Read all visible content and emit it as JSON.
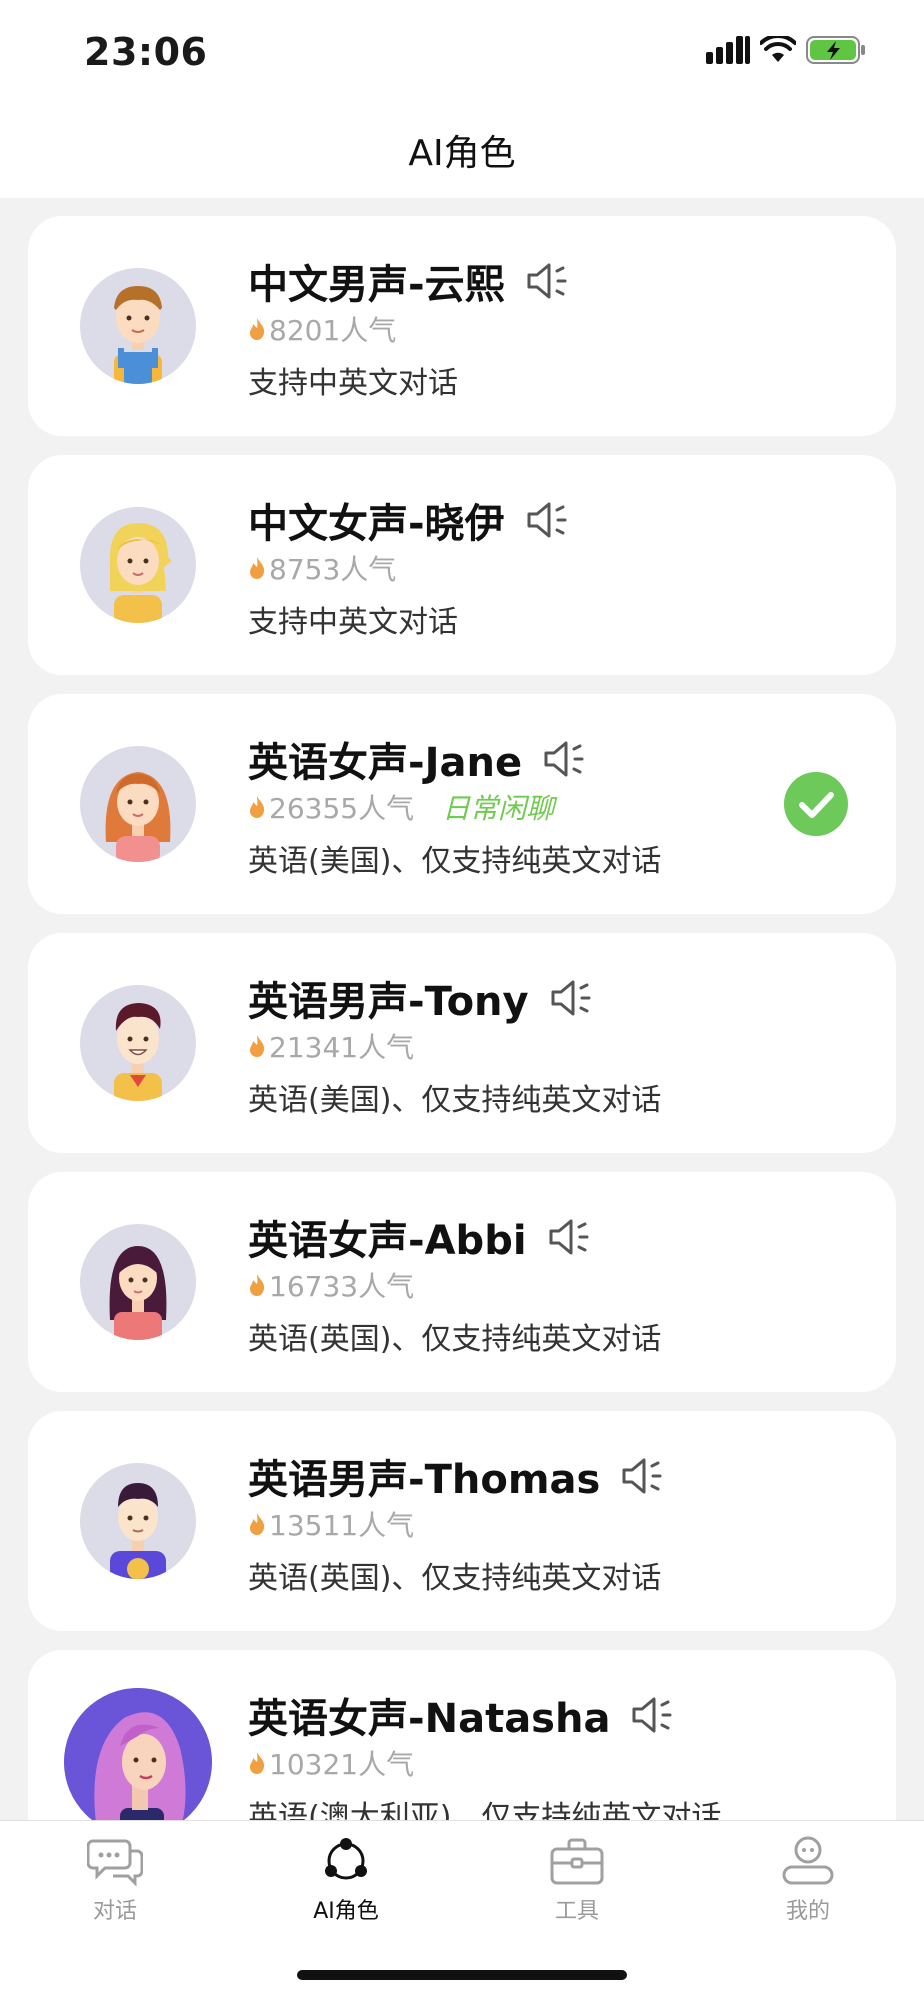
{
  "status_bar": {
    "time": "23:06"
  },
  "nav": {
    "title": "AI角色"
  },
  "roles": [
    {
      "name": "中文男声-云熙",
      "popularity": "8201人气",
      "description": "支持中英文对话",
      "tag": "",
      "selected": false,
      "avatar_icon": "boy-overalls-avatar"
    },
    {
      "name": "中文女声-晓伊",
      "popularity": "8753人气",
      "description": "支持中英文对话",
      "tag": "",
      "selected": false,
      "avatar_icon": "blonde-girl-avatar"
    },
    {
      "name": "英语女声-Jane",
      "popularity": "26355人气",
      "description": "英语(美国)、仅支持纯英文对话",
      "tag": "日常闲聊",
      "selected": true,
      "avatar_icon": "redhead-woman-avatar"
    },
    {
      "name": "英语男声-Tony",
      "popularity": "21341人气",
      "description": "英语(美国)、仅支持纯英文对话",
      "tag": "",
      "selected": false,
      "avatar_icon": "smiling-man-avatar"
    },
    {
      "name": "英语女声-Abbi",
      "popularity": "16733人气",
      "description": "英语(英国)、仅支持纯英文对话",
      "tag": "",
      "selected": false,
      "avatar_icon": "dark-hair-woman-avatar"
    },
    {
      "name": "英语男声-Thomas",
      "popularity": "13511人气",
      "description": "英语(英国)、仅支持纯英文对话",
      "tag": "",
      "selected": false,
      "avatar_icon": "young-man-avatar"
    },
    {
      "name": "英语女声-Natasha",
      "popularity": "10321人气",
      "description": "英语(澳大利亚)、仅支持纯英文对话",
      "tag": "",
      "selected": false,
      "avatar_icon": "pink-hair-woman-avatar"
    }
  ],
  "tabs": [
    {
      "label": "对话",
      "icon": "chat-bubbles-icon",
      "active": false
    },
    {
      "label": "AI角色",
      "icon": "ai-nodes-icon",
      "active": true
    },
    {
      "label": "工具",
      "icon": "toolbox-icon",
      "active": false
    },
    {
      "label": "我的",
      "icon": "profile-icon",
      "active": false
    }
  ],
  "colors": {
    "background": "#f2f2f2",
    "card": "#ffffff",
    "accent_green": "#6cc95a",
    "tag_green": "#6fcb4f",
    "flame_orange": "#f0a040",
    "muted_text": "#a8a8a8"
  }
}
